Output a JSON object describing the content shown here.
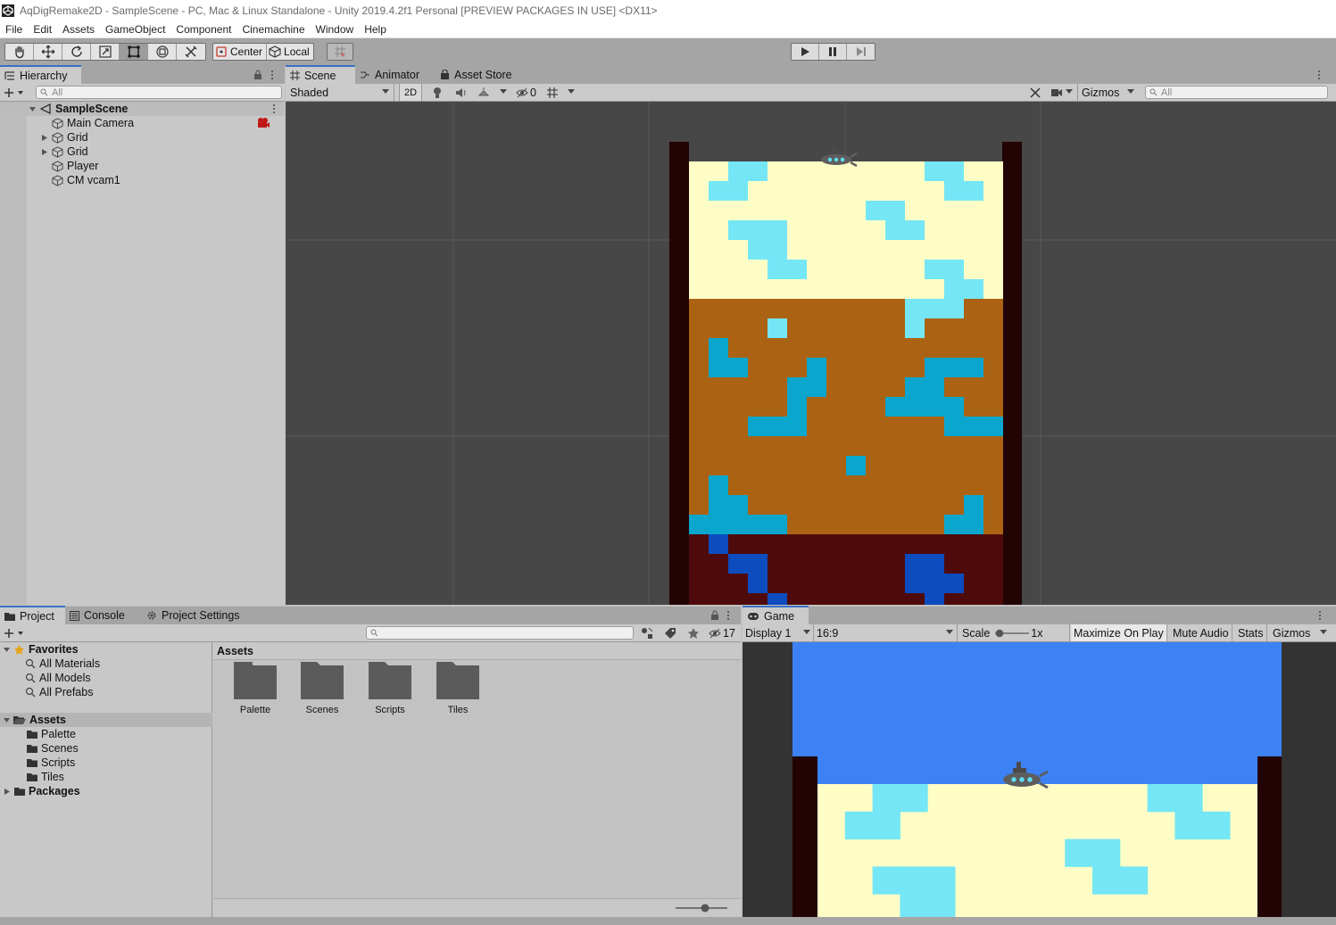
{
  "window": {
    "title": "AqDigRemake2D - SampleScene - PC, Mac & Linux Standalone - Unity 2019.4.2f1 Personal [PREVIEW PACKAGES IN USE] <DX11>"
  },
  "menu": [
    "File",
    "Edit",
    "Assets",
    "GameObject",
    "Component",
    "Cinemachine",
    "Window",
    "Help"
  ],
  "toolbar": {
    "tools": [
      "hand-tool",
      "move-tool",
      "rotate-tool",
      "scale-tool",
      "rect-tool",
      "transform-tool",
      "custom-tool"
    ],
    "active_tool": "rect-tool",
    "pivot_mode": "Center",
    "pivot_rotation": "Local"
  },
  "hierarchy": {
    "tab": "Hierarchy",
    "search_placeholder": "All",
    "scene": "SampleScene",
    "items": [
      {
        "label": "Main Camera",
        "expandable": false
      },
      {
        "label": "Grid",
        "expandable": true
      },
      {
        "label": "Grid",
        "expandable": true
      },
      {
        "label": "Player",
        "expandable": false
      },
      {
        "label": "CM vcam1",
        "expandable": false
      }
    ]
  },
  "scene_view": {
    "tabs": [
      "Scene",
      "Animator",
      "Asset Store"
    ],
    "active_tab": "Scene",
    "shading_mode": "Shaded",
    "mode_2d": "2D",
    "hidden_count": "0",
    "gizmos_label": "Gizmos",
    "search_placeholder": "All"
  },
  "project": {
    "tabs": [
      "Project",
      "Console",
      "Project Settings"
    ],
    "active_tab": "Project",
    "hidden_count": "17",
    "favorites": {
      "label": "Favorites",
      "items": [
        "All Materials",
        "All Models",
        "All Prefabs"
      ]
    },
    "assets_tree": {
      "label": "Assets",
      "items": [
        "Palette",
        "Scenes",
        "Scripts",
        "Tiles"
      ]
    },
    "packages_label": "Packages",
    "breadcrumb": "Assets",
    "folders": [
      "Palette",
      "Scenes",
      "Scripts",
      "Tiles"
    ]
  },
  "game_view": {
    "tab": "Game",
    "display": "Display 1",
    "aspect": "16:9",
    "scale_label": "Scale",
    "scale_value": "1x",
    "buttons": [
      "Maximize On Play",
      "Mute Audio",
      "Stats",
      "Gizmos"
    ],
    "active_buttons": [
      "Maximize On Play"
    ]
  },
  "colors": {
    "sky": "#3d82f5",
    "sand": "#fffdc6",
    "dirt": "#ab6313",
    "deep": "#4f0b0b",
    "wall": "#220404",
    "gem_light": "#75e6f5",
    "gem_mid": "#0aa6cd",
    "gem_dark": "#0d4cbf",
    "accent": "#3a72c4"
  }
}
